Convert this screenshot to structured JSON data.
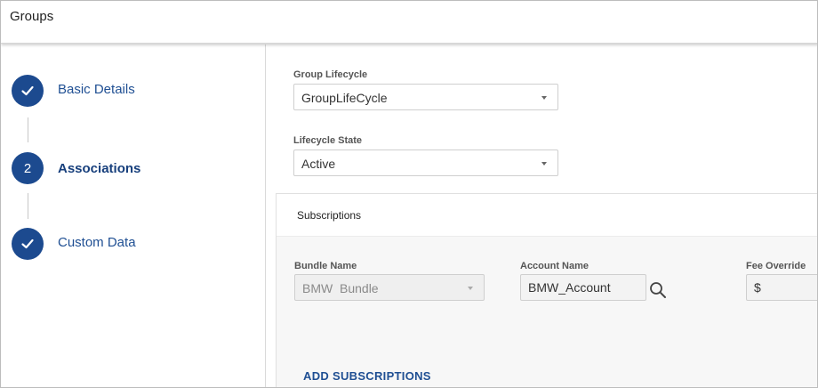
{
  "header": {
    "title": "Groups"
  },
  "steps": [
    {
      "label": "Basic Details",
      "status": "complete",
      "icon": "check-icon"
    },
    {
      "label": "Associations",
      "status": "active",
      "number": "2"
    },
    {
      "label": "Custom Data",
      "status": "complete",
      "icon": "check-icon"
    }
  ],
  "form": {
    "group_lifecycle": {
      "label": "Group Lifecycle",
      "value": "GroupLifeCycle"
    },
    "lifecycle_state": {
      "label": "Lifecycle State",
      "value": "Active"
    }
  },
  "subscriptions": {
    "title": "Subscriptions",
    "bundle_name": {
      "label": "Bundle Name",
      "value": "BMW  Bundle"
    },
    "account_name": {
      "label": "Account Name",
      "value": "BMW_Account"
    },
    "fee_override": {
      "label": "Fee Override",
      "value": "$"
    },
    "add_label": "ADD SUBSCRIPTIONS"
  },
  "colors": {
    "accent": "#1c4a8f",
    "link": "#1f4f93"
  }
}
